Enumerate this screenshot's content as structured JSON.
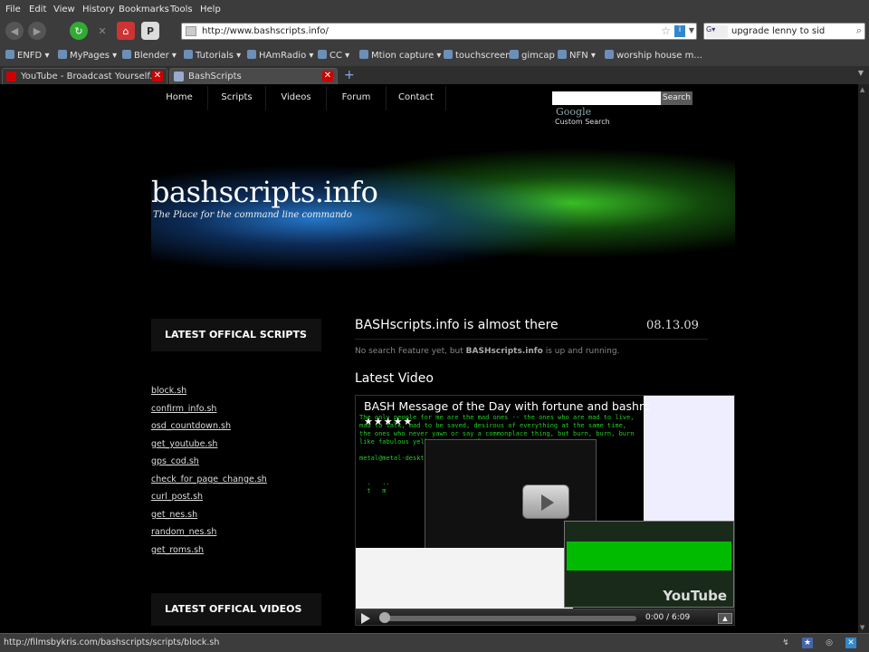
{
  "menubar": {
    "items": [
      "File",
      "Edit",
      "View",
      "History",
      "Bookmarks",
      "Tools",
      "Help"
    ]
  },
  "navbar": {
    "url": "http://www.bashscripts.info/",
    "search_value": "upgrade lenny to sid"
  },
  "bookmarks": [
    "ENFD",
    "MyPages",
    "Blender",
    "Tutorials",
    "HAmRadio",
    "CC",
    "Mtion capture",
    "touchscreen",
    "gimcap",
    "NFN",
    "worship house m..."
  ],
  "tabs": [
    {
      "label": "YouTube - Broadcast Yourself."
    },
    {
      "label": "BashScripts"
    }
  ],
  "site": {
    "nav": [
      "Home",
      "Scripts",
      "Videos",
      "Forum",
      "Contact"
    ],
    "search_button": "Search",
    "google": "Google",
    "custom_search": "Custom Search",
    "title": "bashscripts.info",
    "tagline": "The Place for the command line commando",
    "sidebar_scripts_heading": "LATEST OFFICAL SCRIPTS",
    "scripts": [
      "block.sh",
      "confirm_info.sh",
      "osd_countdown.sh",
      "get_youtube.sh",
      "gps_cod.sh",
      "check_for_page_change.sh",
      "curl_post.sh",
      "get_nes.sh",
      "random_nes.sh",
      "get_roms.sh"
    ],
    "sidebar_videos_heading": "LATEST OFFICAL VIDEOS",
    "post_title": "BASHscripts.info is almost there",
    "post_date": "08.13.09",
    "post_body_pre": "No search Feature yet, but",
    "post_body_bold": "BASHscripts.info",
    "post_body_post": "is up and running.",
    "video_heading": "Latest Video",
    "video_title": "BASH Message of the Day with fortune and bashrc",
    "video_time": "0:00 / 6:09",
    "video_brand": "YouTube"
  },
  "status": {
    "text": "http://filmsbykris.com/bashscripts/scripts/block.sh"
  }
}
